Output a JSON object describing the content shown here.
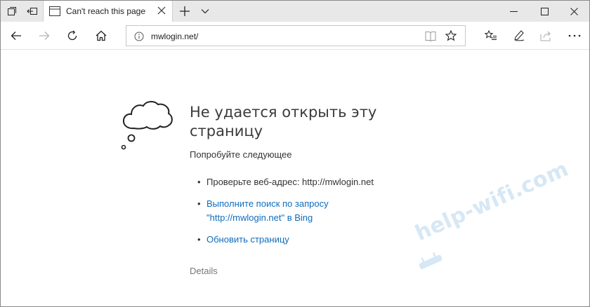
{
  "browser": {
    "tab": {
      "title": "Can't reach this page"
    },
    "address": {
      "url": "mwlogin.net/"
    }
  },
  "error": {
    "heading": "Не удается открыть эту страницу",
    "subheading": "Попробуйте следующее",
    "items": [
      {
        "text": "Проверьте веб-адрес: http://mwlogin.net",
        "link": false
      },
      {
        "text": "Выполните поиск по запросу \"http://mwlogin.net\" в Bing",
        "link": true
      },
      {
        "text": "Обновить страницу",
        "link": true
      }
    ],
    "details": "Details"
  },
  "watermark": {
    "text": "help-wifi.com"
  },
  "colors": {
    "link": "#0f6cbd",
    "tabbar": "#e8e8e8",
    "watermark": "#d6e8f5"
  },
  "icons": [
    "tab-set-aside-icon",
    "tab-preview-icon",
    "tab-page-icon",
    "close-icon",
    "new-tab-icon",
    "chevron-down-icon",
    "minimize-icon",
    "maximize-icon",
    "close-window-icon",
    "back-icon",
    "forward-icon",
    "refresh-icon",
    "home-icon",
    "info-icon",
    "reading-view-icon",
    "favorite-star-icon",
    "favorites-hub-icon",
    "pen-icon",
    "share-icon",
    "more-icon",
    "cloud-icon",
    "router-icon"
  ]
}
